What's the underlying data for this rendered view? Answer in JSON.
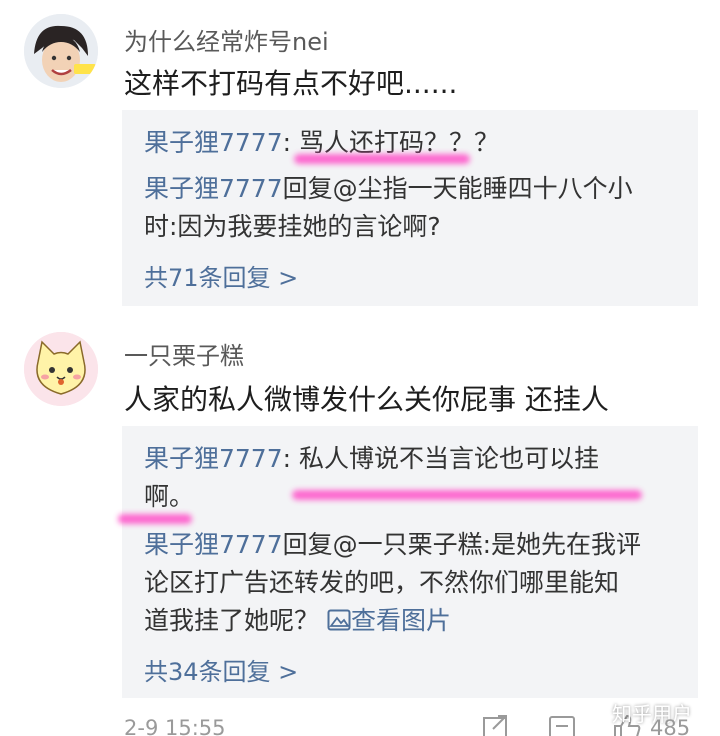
{
  "comments": [
    {
      "username": "为什么经常炸号nei",
      "content": "这样不打码有点不好吧......",
      "replies": [
        {
          "name": "果子狸7777",
          "text": ": 骂人还打码？？？"
        },
        {
          "name": "果子狸7777",
          "line1": "回复@尘指一天能睡四十八个小",
          "line2": "时:因为我要挂她的言论啊?"
        }
      ],
      "more": "共71条回复 >"
    },
    {
      "username": "一只栗子糕",
      "content": "人家的私人微博发什么关你屁事 还挂人",
      "replies": [
        {
          "name": "果子狸7777",
          "line1": ": 私人博说不当言论也可以挂",
          "line2": "啊。"
        },
        {
          "name": "果子狸7777",
          "line1": "回复@一只栗子糕:是她先在我评",
          "line2": "论区打广告还转发的吧，不然你们哪里能知",
          "line3": "道我挂了她呢？",
          "link": "查看图片"
        }
      ],
      "more": "共34条回复 >"
    }
  ],
  "footer": {
    "time": "2-9 15:55",
    "likes": "485",
    "watermark": "知乎用户"
  },
  "icons": {
    "share": "share-icon",
    "comment": "comment-icon",
    "like": "like-icon",
    "image": "image-icon"
  },
  "colors": {
    "link": "#4e6f9a",
    "highlight": "#ff4fc8",
    "reply_bg": "#f3f4f6"
  }
}
